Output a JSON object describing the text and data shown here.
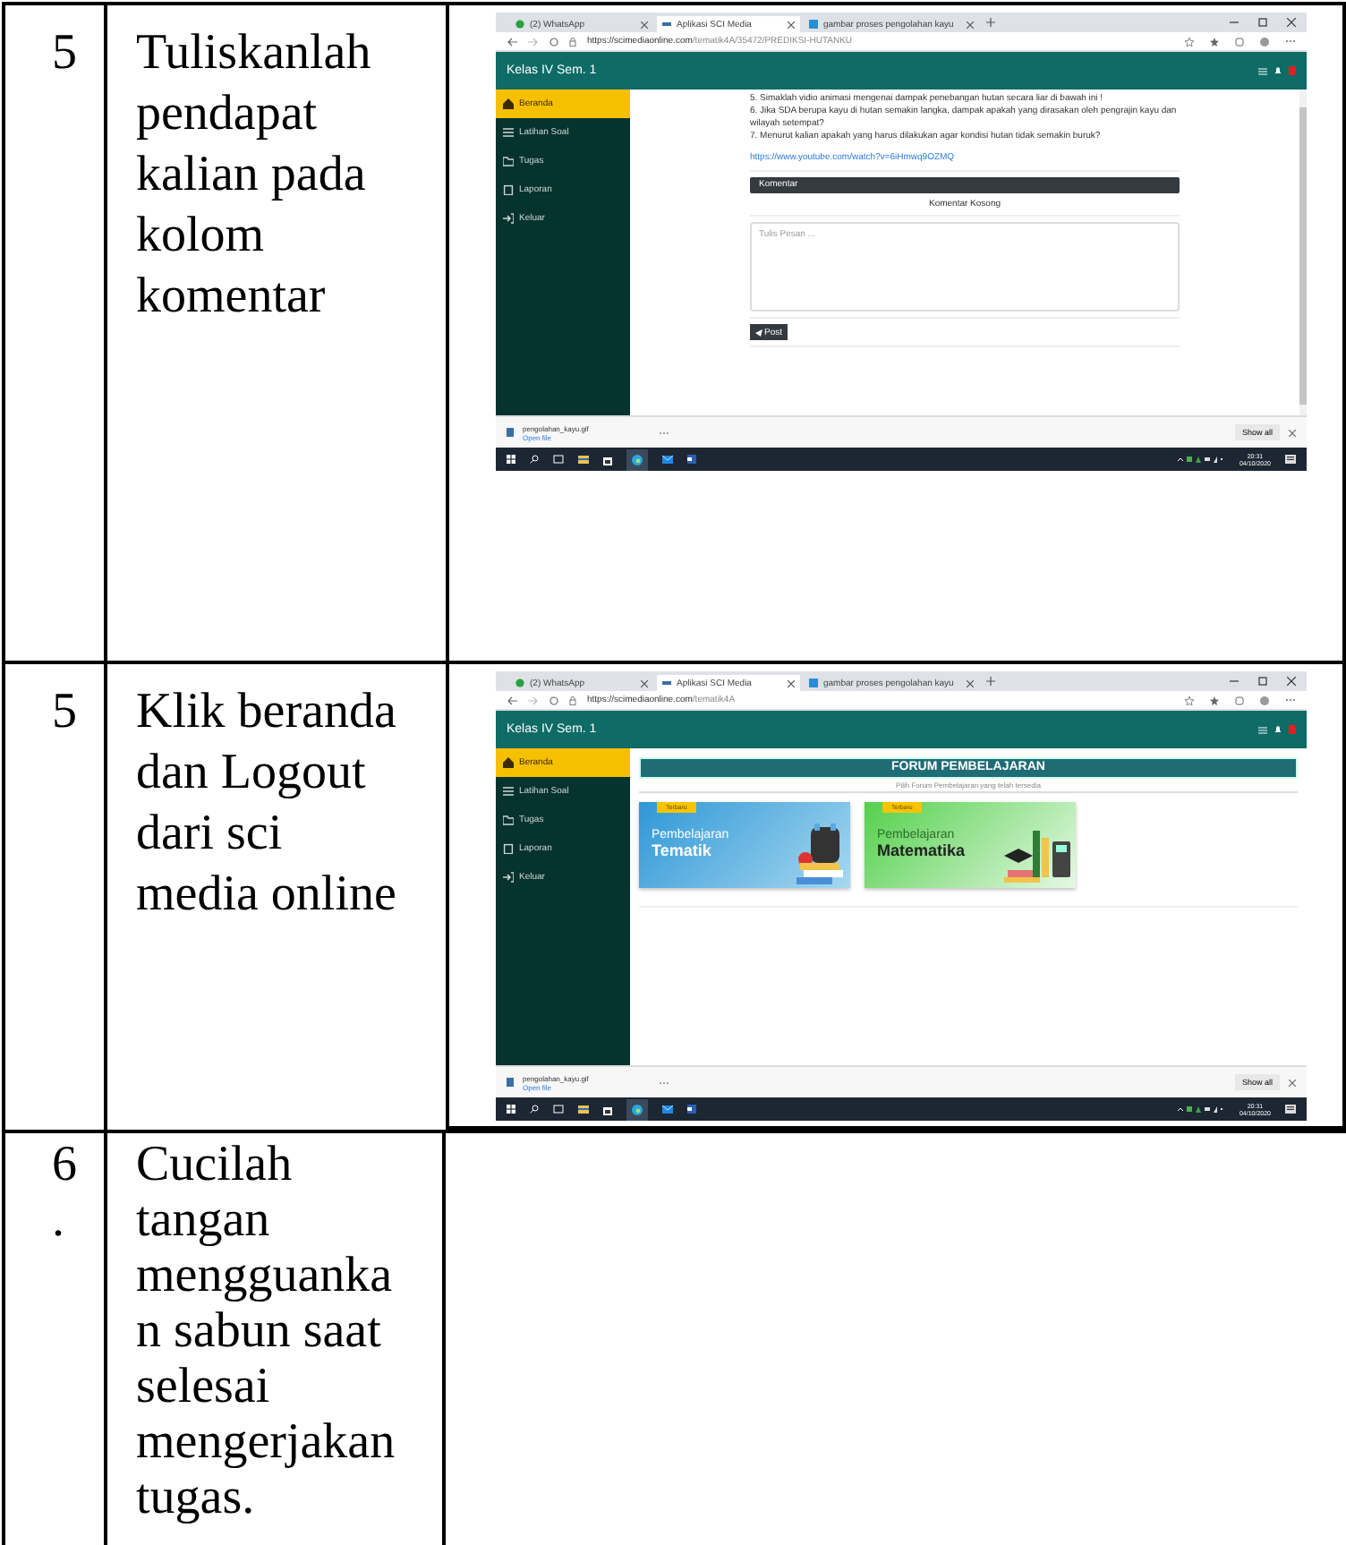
{
  "rows": [
    {
      "number": "5",
      "instruction": "Tuliskanlah pendapat kalian pada kolom komentar",
      "screenshot": {
        "browser_tabs": [
          {
            "title": "(2) WhatsApp",
            "kind": "whatsapp",
            "selected": false
          },
          {
            "title": "Aplikasi SCI Media",
            "kind": "site",
            "selected": true
          },
          {
            "title": "gambar proses pengolahan kayu",
            "kind": "search",
            "selected": false
          }
        ],
        "url": {
          "host": "https://scimediaonline.com",
          "path": "/tematik4A/35472/PREDIKSI-HUTANKU"
        },
        "app_title": "Kelas IV Sem. 1",
        "sidebar": [
          {
            "label": "Beranda",
            "kind": "home",
            "selected": true
          },
          {
            "label": "Latihan Soal",
            "kind": "list",
            "selected": false
          },
          {
            "label": "Tugas",
            "kind": "folder",
            "selected": false
          },
          {
            "label": "Laporan",
            "kind": "clipboard",
            "selected": false
          },
          {
            "label": "Keluar",
            "kind": "exit",
            "selected": false
          }
        ],
        "content": {
          "kind": "lesson",
          "questions": [
            "5. Simaklah vidio animasi mengenai dampak penebangan hutan secara liar di bawah ini !",
            "6. Jika SDA berupa kayu di hutan semakin langka, dampak apakah yang dirasakan oleh pengrajin kayu dan wilayah setempat?",
            "7. Menurut kalian apakah yang harus dilakukan agar kondisi hutan tidak semakin buruk?"
          ],
          "link": "https://www.youtube.com/watch?v=6iHmwq9OZMQ",
          "comment_header": "Komentar",
          "comment_status": "Komentar Kosong",
          "message_placeholder": "Tulis Pesan ...",
          "post_button": "Post"
        },
        "download": {
          "file": "pengolahan_kayu.gif",
          "action": "Open file",
          "show_all": "Show all"
        },
        "clock": {
          "time": "20:31",
          "date": "04/10/2020"
        }
      }
    },
    {
      "number": "5",
      "instruction": "Klik beranda dan Logout dari sci media online",
      "screenshot": {
        "browser_tabs": [
          {
            "title": "(2) WhatsApp",
            "kind": "whatsapp",
            "selected": false
          },
          {
            "title": "Aplikasi SCI Media",
            "kind": "site",
            "selected": true
          },
          {
            "title": "gambar proses pengolahan kayu",
            "kind": "search",
            "selected": false
          }
        ],
        "url": {
          "host": "https://scimediaonline.com",
          "path": "/tematik4A"
        },
        "app_title": "Kelas IV Sem. 1",
        "sidebar": [
          {
            "label": "Beranda",
            "kind": "home",
            "selected": true
          },
          {
            "label": "Latihan Soal",
            "kind": "list",
            "selected": false
          },
          {
            "label": "Tugas",
            "kind": "folder",
            "selected": false
          },
          {
            "label": "Laporan",
            "kind": "clipboard",
            "selected": false
          },
          {
            "label": "Keluar",
            "kind": "exit",
            "selected": false
          }
        ],
        "content": {
          "kind": "forum",
          "banner": "FORUM PEMBELAJARAN",
          "subtitle": "Pilih Forum Pembelajaran yang telah tersedia",
          "cards": [
            {
              "tag": "Terbaru",
              "subtitle": "Pembelajaran",
              "title": "Tematik",
              "kind": "books"
            },
            {
              "tag": "Terbaru",
              "subtitle": "Pembelajaran",
              "title": "Matematika",
              "kind": "math"
            }
          ]
        },
        "download": {
          "file": "pengolahan_kayu.gif",
          "action": "Open file",
          "show_all": "Show all"
        },
        "clock": {
          "time": "20:31",
          "date": "04/10/2020"
        }
      }
    },
    {
      "number": "6.",
      "instruction": "Cucilah tangan mengguankan sabun saat selesai mengerjakan tugas."
    }
  ]
}
